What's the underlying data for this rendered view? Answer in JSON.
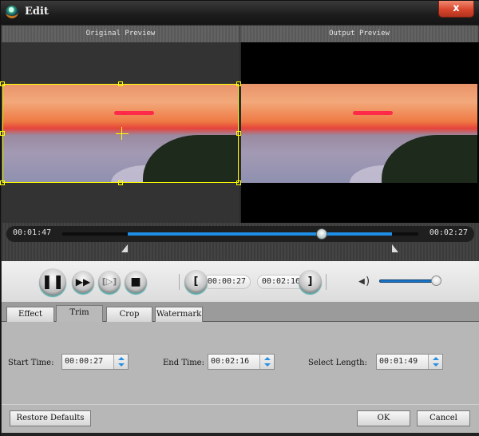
{
  "window": {
    "title": "Edit",
    "close_label": "x"
  },
  "preview": {
    "original_label": "Original Preview",
    "output_label": "Output Preview"
  },
  "timeline": {
    "current_time": "00:01:47",
    "total_time": "00:02:27",
    "selection_start_fraction": 0.184,
    "selection_end_fraction": 0.925,
    "playhead_fraction": 0.728
  },
  "controls": {
    "pause_icon": "pause-icon",
    "fast_forward_icon": "fast-forward-icon",
    "next_frame_icon": "next-frame-icon",
    "stop_icon": "stop-icon",
    "set_start_label": "[",
    "set_end_label": "]",
    "start_time": "00:00:27",
    "end_time": "00:02:16",
    "volume_icon": "volume-icon",
    "volume_level": 0.95
  },
  "tabs": [
    {
      "label": "Effect",
      "active": false
    },
    {
      "label": "Trim",
      "active": true
    },
    {
      "label": "Crop",
      "active": false
    },
    {
      "label": "Watermark",
      "active": false
    }
  ],
  "trim": {
    "start_label": "Start Time:",
    "start_value": "00:00:27",
    "end_label": "End Time:",
    "end_value": "00:02:16",
    "length_label": "Select Length:",
    "length_value": "00:01:49"
  },
  "footer": {
    "restore_label": "Restore Defaults",
    "ok_label": "OK",
    "cancel_label": "Cancel"
  },
  "colors": {
    "accent": "#1e8ee6",
    "crop_frame": "#ffff00",
    "close_button": "#d8452c"
  }
}
